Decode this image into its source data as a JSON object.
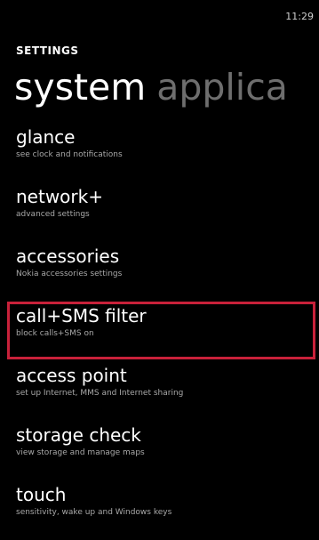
{
  "status": {
    "time": "11:29"
  },
  "app_title": "SETTINGS",
  "pivot": {
    "active": "system",
    "next": "applica"
  },
  "accent_color": "#c8213a",
  "items": [
    {
      "title": "glance",
      "subtitle": "see clock and notifications"
    },
    {
      "title": "network+",
      "subtitle": "advanced settings"
    },
    {
      "title": "accessories",
      "subtitle": "Nokia accessories settings"
    },
    {
      "title": "call+SMS filter",
      "subtitle": "block calls+SMS on",
      "highlighted": true
    },
    {
      "title": "access point",
      "subtitle": "set up Internet, MMS and Internet sharing"
    },
    {
      "title": "storage check",
      "subtitle": "view storage and manage maps"
    },
    {
      "title": "touch",
      "subtitle": "sensitivity, wake up and Windows keys"
    }
  ]
}
